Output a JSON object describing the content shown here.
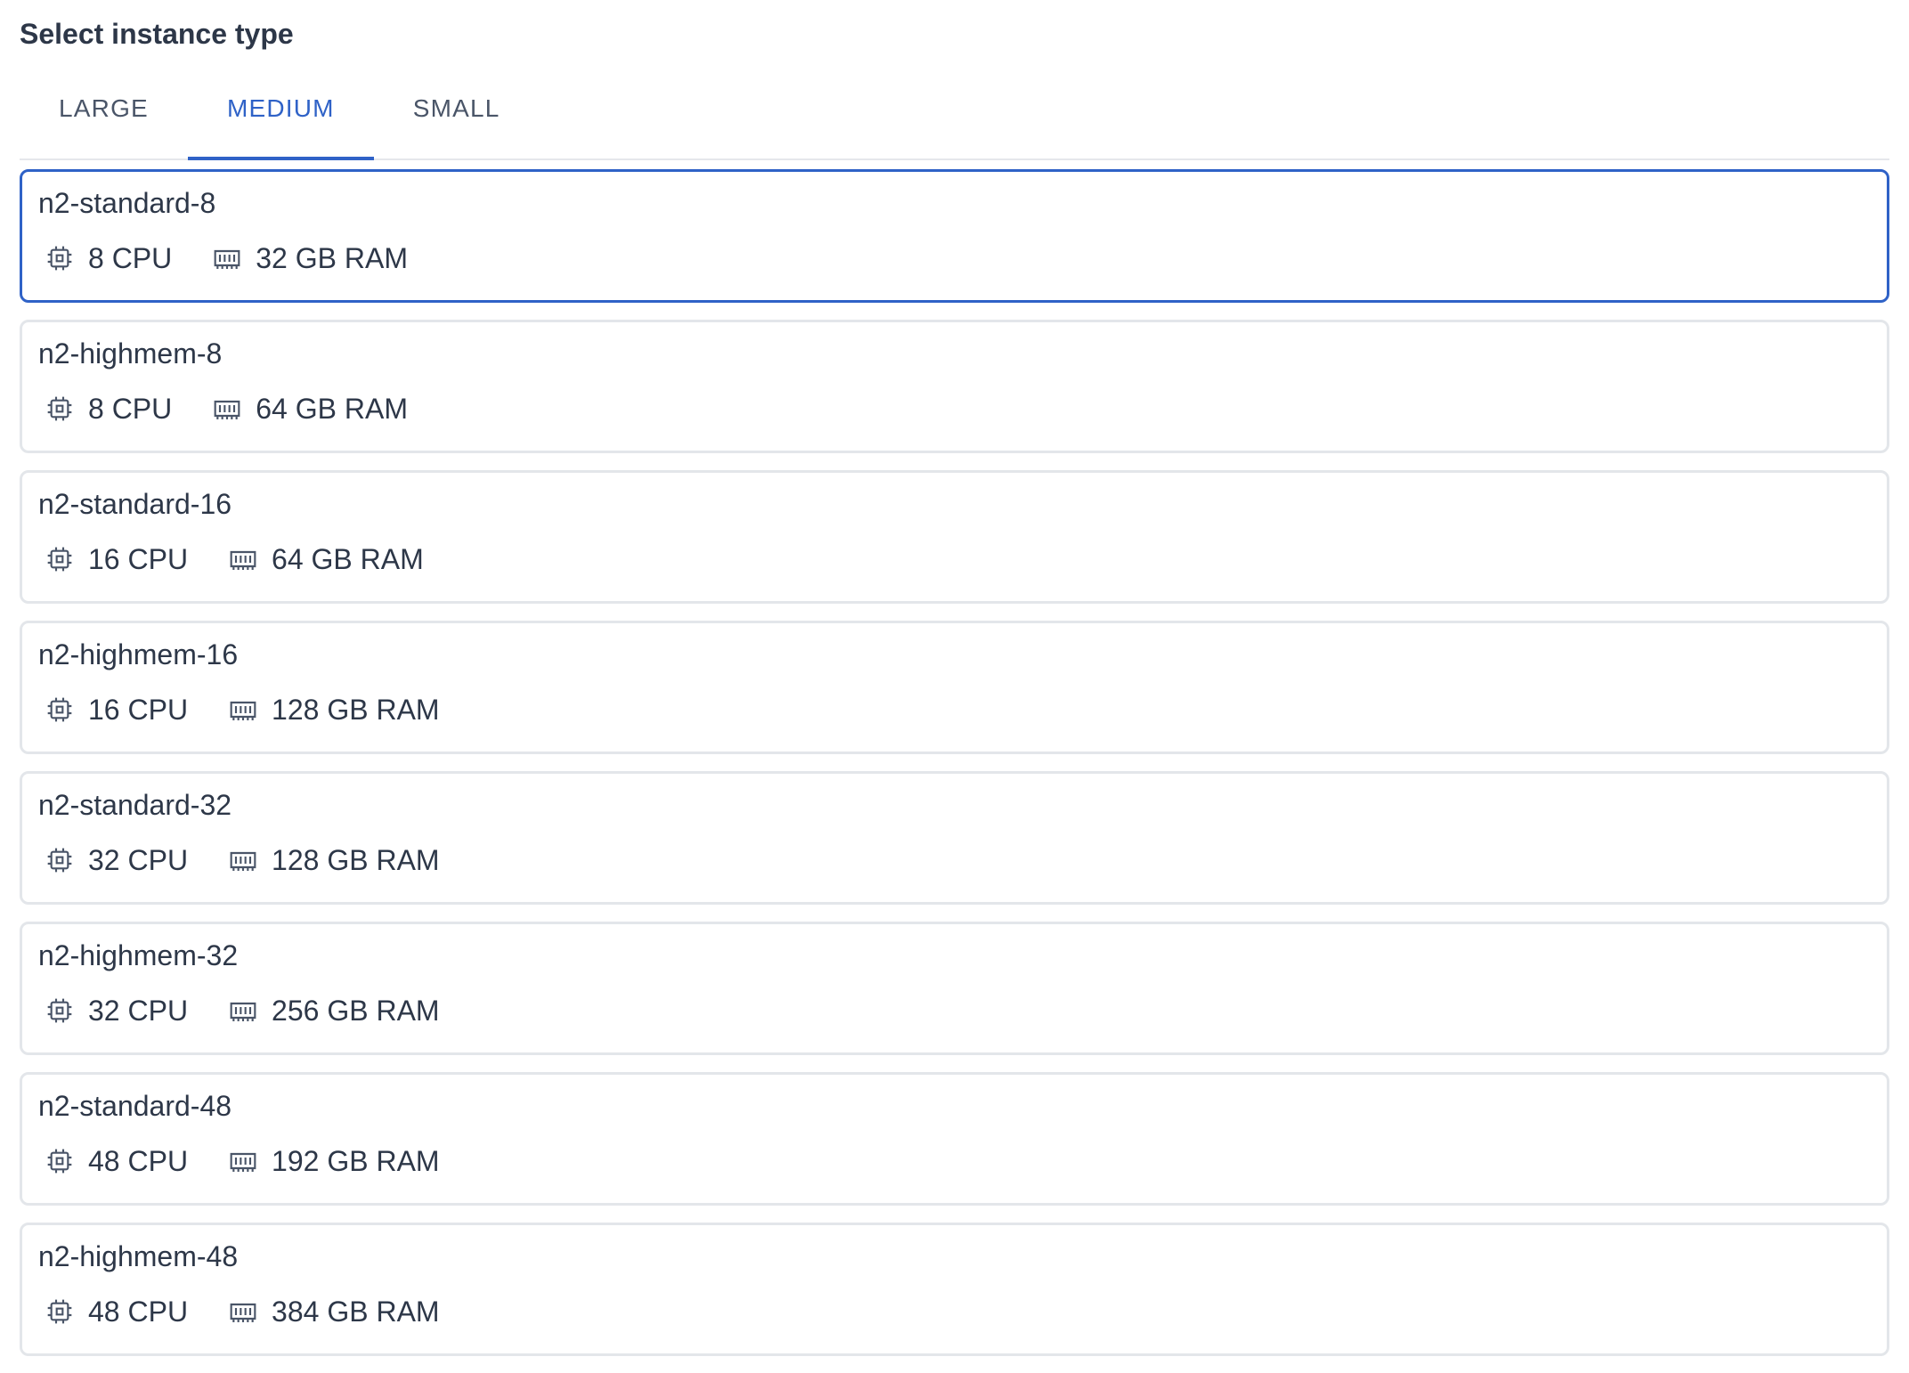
{
  "header": {
    "title": "Select instance type"
  },
  "tabs": [
    {
      "label": "LARGE",
      "active": false
    },
    {
      "label": "MEDIUM",
      "active": true
    },
    {
      "label": "SMALL",
      "active": false
    }
  ],
  "colors": {
    "accent": "#2f62c7",
    "border": "#e3e6ea",
    "text": "#2d3748"
  },
  "icons": {
    "cpu": "cpu-icon",
    "ram": "memory-icon"
  },
  "instances": [
    {
      "name": "n2-standard-8",
      "cpu": "8 CPU",
      "ram": "32 GB RAM",
      "selected": true
    },
    {
      "name": "n2-highmem-8",
      "cpu": "8 CPU",
      "ram": "64 GB RAM",
      "selected": false
    },
    {
      "name": "n2-standard-16",
      "cpu": "16 CPU",
      "ram": "64 GB RAM",
      "selected": false
    },
    {
      "name": "n2-highmem-16",
      "cpu": "16 CPU",
      "ram": "128 GB RAM",
      "selected": false
    },
    {
      "name": "n2-standard-32",
      "cpu": "32 CPU",
      "ram": "128 GB RAM",
      "selected": false
    },
    {
      "name": "n2-highmem-32",
      "cpu": "32 CPU",
      "ram": "256 GB RAM",
      "selected": false
    },
    {
      "name": "n2-standard-48",
      "cpu": "48 CPU",
      "ram": "192 GB RAM",
      "selected": false
    },
    {
      "name": "n2-highmem-48",
      "cpu": "48 CPU",
      "ram": "384 GB RAM",
      "selected": false
    }
  ]
}
